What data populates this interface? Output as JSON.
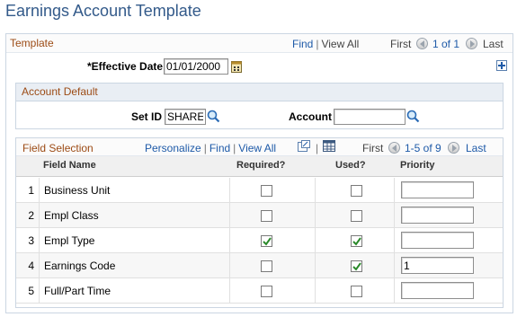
{
  "page": {
    "title": "Earnings Account Template"
  },
  "template": {
    "title": "Template",
    "find_label": "Find",
    "view_all_label": "View All",
    "first_label": "First",
    "range_label": "1 of 1",
    "last_label": "Last",
    "effective_date_label": "*Effective Date",
    "effective_date_value": "01/01/2000"
  },
  "account_default": {
    "title": "Account Default",
    "setid_label": "Set ID",
    "setid_value": "SHARE",
    "account_label": "Account",
    "account_value": ""
  },
  "field_selection": {
    "title": "Field Selection",
    "personalize_label": "Personalize",
    "find_label": "Find",
    "view_all_label": "View All",
    "first_label": "First",
    "range_label": "1-5 of 9",
    "last_label": "Last",
    "columns": {
      "field_name": "Field Name",
      "required": "Required?",
      "used": "Used?",
      "priority": "Priority"
    },
    "rows": [
      {
        "num": "1",
        "field": "Business Unit",
        "required": false,
        "used": false,
        "priority": ""
      },
      {
        "num": "2",
        "field": "Empl Class",
        "required": false,
        "used": false,
        "priority": ""
      },
      {
        "num": "3",
        "field": "Empl Type",
        "required": true,
        "used": true,
        "priority": ""
      },
      {
        "num": "4",
        "field": "Earnings Code",
        "required": false,
        "used": true,
        "priority": "1"
      },
      {
        "num": "5",
        "field": "Full/Part Time",
        "required": false,
        "used": false,
        "priority": ""
      }
    ]
  },
  "colors": {
    "title": "#335a8a",
    "group_title": "#9c4b15",
    "link": "#1e5aa8",
    "check": "#2b8a2b"
  }
}
